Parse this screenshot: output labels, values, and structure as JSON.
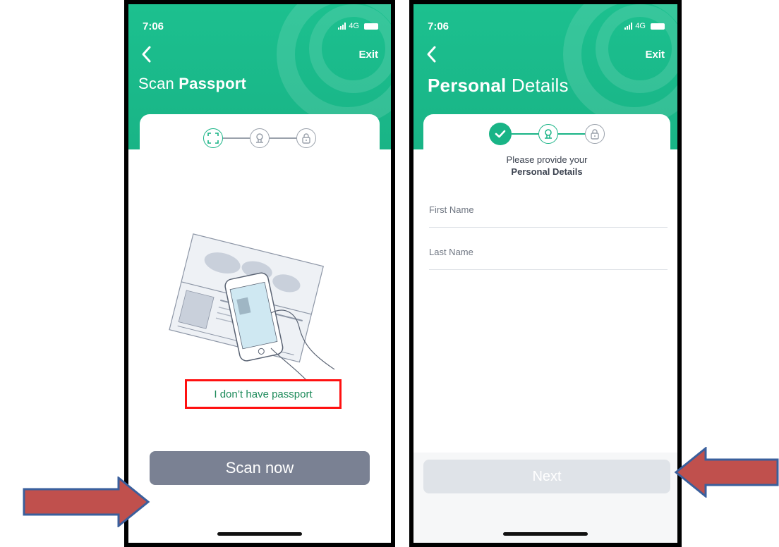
{
  "colors": {
    "brand_green": "#19b486",
    "link_green": "#1e8b5b",
    "scan_button": "#7a8193",
    "next_button_disabled": "#dfe3e8",
    "highlight_red": "#ff1010",
    "arrow_fill": "#c0504d",
    "arrow_outline": "#3a5f9c"
  },
  "left_screen": {
    "status": {
      "time": "7:06",
      "network": "4G"
    },
    "header": {
      "back_icon": "chevron-left-icon",
      "exit_label": "Exit",
      "title_prefix": "Scan ",
      "title_emphasis": "Passport"
    },
    "stepper": {
      "steps": [
        {
          "icon": "scan-frame-icon",
          "state": "active"
        },
        {
          "icon": "user-icon",
          "state": "pending"
        },
        {
          "icon": "lock-icon",
          "state": "pending"
        }
      ]
    },
    "illustration": "passport-scan-illustration",
    "scan_button_label": "Scan now",
    "no_passport_link": "I don’t have passport"
  },
  "right_screen": {
    "status": {
      "time": "7:06",
      "network": "4G"
    },
    "header": {
      "back_icon": "chevron-left-icon",
      "exit_label": "Exit",
      "title_emphasis": "Personal",
      "title_suffix": " Details"
    },
    "stepper": {
      "steps": [
        {
          "icon": "check-icon",
          "state": "done"
        },
        {
          "icon": "user-icon",
          "state": "active"
        },
        {
          "icon": "lock-icon",
          "state": "pending"
        }
      ]
    },
    "prompt_line1": "Please provide your",
    "prompt_line2": "Personal Details",
    "fields": {
      "first_name_placeholder": "First Name",
      "first_name_value": "",
      "last_name_placeholder": "Last Name",
      "last_name_value": ""
    },
    "next_button_label": "Next"
  }
}
